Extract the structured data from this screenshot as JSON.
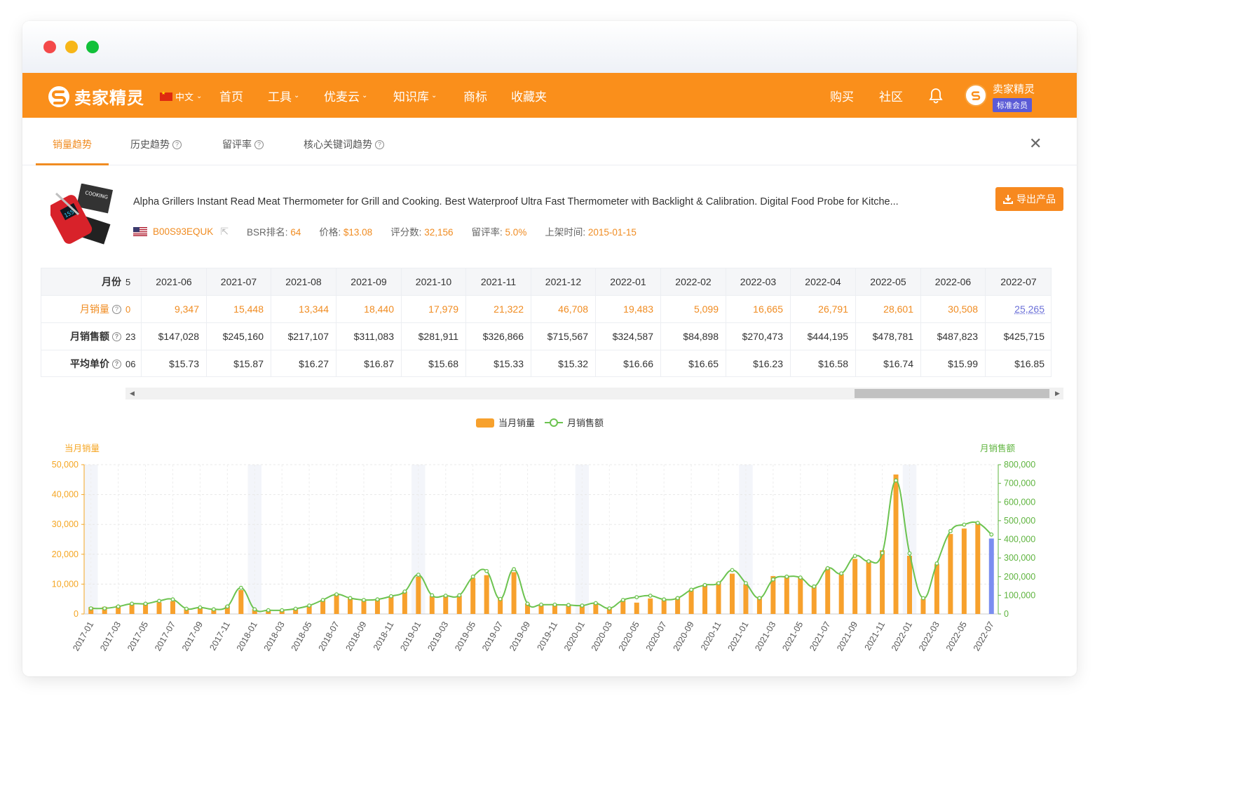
{
  "navbar": {
    "brand": "卖家精灵",
    "lang": "中文",
    "items": [
      {
        "label": "首页",
        "caret": false
      },
      {
        "label": "工具",
        "caret": true
      },
      {
        "label": "优麦云",
        "caret": true
      },
      {
        "label": "知识库",
        "caret": true
      },
      {
        "label": "商标",
        "caret": false
      },
      {
        "label": "收藏夹",
        "caret": false
      }
    ],
    "right": [
      "购买",
      "社区"
    ],
    "user_name": "卖家精灵",
    "member_badge": "标准会员"
  },
  "tabs": [
    {
      "label": "销量趋势",
      "help": false
    },
    {
      "label": "历史趋势",
      "help": true
    },
    {
      "label": "留评率",
      "help": true
    },
    {
      "label": "核心关键词趋势",
      "help": true
    }
  ],
  "product": {
    "title": "Alpha Grillers Instant Read Meat Thermometer for Grill and Cooking. Best Waterproof Ultra Fast Thermometer with Backlight & Calibration. Digital Food Probe for Kitche...",
    "asin": "B00S93EQUK",
    "bsr_label": "BSR排名:",
    "bsr": "64",
    "price_label": "价格:",
    "price": "$13.08",
    "rating_label": "评分数:",
    "rating_count": "32,156",
    "review_rate_label": "留评率:",
    "review_rate": "5.0%",
    "listed_label": "上架时间:",
    "listed": "2015-01-15",
    "export_label": "导出产品"
  },
  "table": {
    "row_labels": [
      "月份",
      "月销量",
      "月销售额",
      "平均单价"
    ],
    "stubs": [
      "5",
      "0",
      "23",
      "06"
    ],
    "months": [
      "2021-06",
      "2021-07",
      "2021-08",
      "2021-09",
      "2021-10",
      "2021-11",
      "2021-12",
      "2022-01",
      "2022-02",
      "2022-03",
      "2022-04",
      "2022-05",
      "2022-06",
      "2022-07"
    ],
    "sales": [
      "9,347",
      "15,448",
      "13,344",
      "18,440",
      "17,979",
      "21,322",
      "46,708",
      "19,483",
      "5,099",
      "16,665",
      "26,791",
      "28,601",
      "30,508",
      "25,265"
    ],
    "revenue": [
      "$147,028",
      "$245,160",
      "$217,107",
      "$311,083",
      "$281,911",
      "$326,866",
      "$715,567",
      "$324,587",
      "$84,898",
      "$270,473",
      "$444,195",
      "$478,781",
      "$487,823",
      "$425,715"
    ],
    "avg_price": [
      "$15.73",
      "$15.87",
      "$16.27",
      "$16.87",
      "$15.68",
      "$15.33",
      "$15.32",
      "$16.66",
      "$16.65",
      "$16.23",
      "$16.58",
      "$16.74",
      "$15.99",
      "$16.85"
    ]
  },
  "chart_data": {
    "type": "bar",
    "legend": [
      "当月销量",
      "月销售额"
    ],
    "left_axis_title": "当月销量",
    "right_axis_title": "月销售额",
    "left_ticks": [
      "0",
      "10,000",
      "20,000",
      "30,000",
      "40,000",
      "50,000"
    ],
    "right_ticks": [
      "0",
      "100,000",
      "200,000",
      "300,000",
      "400,000",
      "500,000",
      "600,000",
      "700,000",
      "800,000"
    ],
    "ylim_left": [
      0,
      50000
    ],
    "ylim_right": [
      0,
      800000
    ],
    "x_labels": [
      "2017-01",
      "2017-03",
      "2017-05",
      "2017-07",
      "2017-09",
      "2017-11",
      "2018-01",
      "2018-03",
      "2018-05",
      "2018-07",
      "2018-09",
      "2018-11",
      "2019-01",
      "2019-03",
      "2019-05",
      "2019-07",
      "2019-09",
      "2019-11",
      "2020-01",
      "2020-03",
      "2020-05",
      "2020-07",
      "2020-09",
      "2020-11",
      "2021-01",
      "2021-03",
      "2021-05",
      "2021-07",
      "2021-09",
      "2021-11",
      "2022-01",
      "2022-03",
      "2022-05",
      "2022-07"
    ],
    "months": [
      "2017-01",
      "2017-02",
      "2017-03",
      "2017-04",
      "2017-05",
      "2017-06",
      "2017-07",
      "2017-08",
      "2017-09",
      "2017-10",
      "2017-11",
      "2017-12",
      "2018-01",
      "2018-02",
      "2018-03",
      "2018-04",
      "2018-05",
      "2018-06",
      "2018-07",
      "2018-08",
      "2018-09",
      "2018-10",
      "2018-11",
      "2018-12",
      "2019-01",
      "2019-02",
      "2019-03",
      "2019-04",
      "2019-05",
      "2019-06",
      "2019-07",
      "2019-08",
      "2019-09",
      "2019-10",
      "2019-11",
      "2019-12",
      "2020-01",
      "2020-02",
      "2020-03",
      "2020-04",
      "2020-05",
      "2020-06",
      "2020-07",
      "2020-08",
      "2020-09",
      "2020-10",
      "2020-11",
      "2020-12",
      "2021-01",
      "2021-02",
      "2021-03",
      "2021-04",
      "2021-05",
      "2021-06",
      "2021-07",
      "2021-08",
      "2021-09",
      "2021-10",
      "2021-11",
      "2021-12",
      "2022-01",
      "2022-02",
      "2022-03",
      "2022-04",
      "2022-05",
      "2022-06",
      "2022-07"
    ],
    "series": [
      {
        "name": "当月销量",
        "type": "bar",
        "axis": "left",
        "values": [
          2300,
          2400,
          2800,
          3300,
          3500,
          3900,
          4300,
          1600,
          2300,
          1500,
          2800,
          8000,
          1600,
          1200,
          1200,
          1800,
          2800,
          4700,
          6800,
          5200,
          4800,
          4800,
          6000,
          7500,
          12500,
          6000,
          6100,
          6200,
          12000,
          13000,
          5500,
          14000,
          3500,
          3200,
          3200,
          3100,
          3000,
          3800,
          2000,
          4700,
          3800,
          5200,
          4800,
          5500,
          8200,
          9800,
          10700,
          13500,
          10000,
          5700,
          12700,
          12800,
          12200,
          9347,
          15448,
          13344,
          18440,
          17979,
          21322,
          46708,
          19483,
          5099,
          16665,
          26791,
          28601,
          30508,
          25265
        ]
      },
      {
        "name": "月销售额",
        "type": "line",
        "axis": "right",
        "values": [
          30000,
          30000,
          40000,
          55000,
          55000,
          70000,
          78000,
          28000,
          35000,
          25000,
          40000,
          140000,
          25000,
          20000,
          20000,
          28000,
          45000,
          75000,
          105000,
          85000,
          75000,
          78000,
          95000,
          120000,
          210000,
          100000,
          98000,
          100000,
          200000,
          230000,
          80000,
          240000,
          55000,
          50000,
          50000,
          48000,
          45000,
          58000,
          30000,
          75000,
          90000,
          98000,
          78000,
          85000,
          130000,
          155000,
          165000,
          235000,
          165000,
          85000,
          185000,
          200000,
          195000,
          147028,
          245160,
          217107,
          311083,
          281911,
          326866,
          715567,
          324587,
          84898,
          270473,
          444195,
          478781,
          487823,
          425715
        ]
      }
    ],
    "colors": {
      "bar": "#f7a12d",
      "line": "#6cc350",
      "last_bar": "#7b8ef0",
      "left_axis": "#f5a623",
      "right_axis": "#5fb43f",
      "band": "#f3f5fa"
    }
  }
}
